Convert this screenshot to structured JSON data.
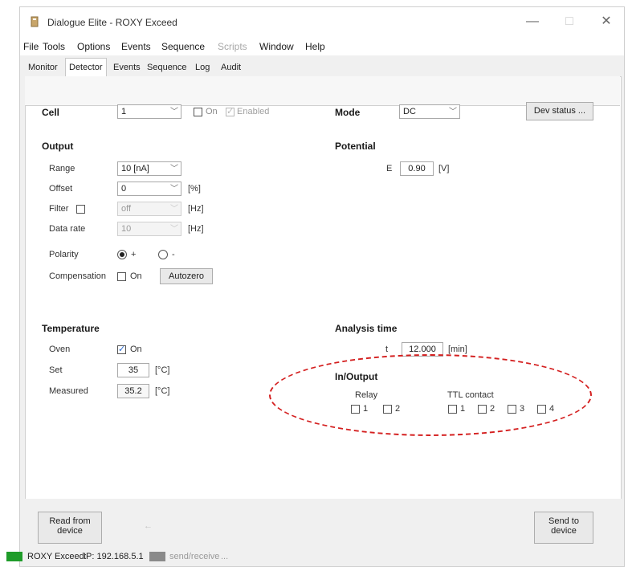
{
  "window": {
    "title": "Dialogue Elite - ROXY Exceed",
    "controls": {
      "minimize": "—",
      "maximize": "□",
      "close": "✕"
    }
  },
  "menu": [
    "File",
    "Tools",
    "Options",
    "Events",
    "Sequence",
    "Scripts",
    "Window",
    "Help"
  ],
  "tabs": [
    "Monitor",
    "Detector",
    "Events",
    "Sequence",
    "Log",
    "Audit"
  ],
  "header": {
    "cell_label": "Cell",
    "cell_value": "1",
    "on_label": "On",
    "enabled_label": "Enabled",
    "mode_label": "Mode",
    "mode_value": "DC",
    "dev_status_label": "Dev status ..."
  },
  "output": {
    "title": "Output",
    "range_label": "Range",
    "range_value": "10 [nA]",
    "offset_label": "Offset",
    "offset_value": "0",
    "offset_unit": "[%]",
    "filter_label": "Filter",
    "filter_value": "off",
    "filter_unit": "[Hz]",
    "datarate_label": "Data rate",
    "datarate_value": "10",
    "datarate_unit": "[Hz]",
    "polarity_label": "Polarity",
    "polarity_plus": "+",
    "polarity_minus": "-",
    "compensation_label": "Compensation",
    "comp_on_label": "On",
    "autozero_label": "Autozero"
  },
  "potential": {
    "title": "Potential",
    "e_label": "E",
    "e_value": "0.90",
    "e_unit": "[V]"
  },
  "temperature": {
    "title": "Temperature",
    "oven_label": "Oven",
    "oven_on_label": "On",
    "set_label": "Set",
    "set_value": "35",
    "set_unit": "[°C]",
    "measured_label": "Measured",
    "measured_value": "35.2",
    "measured_unit": "[°C]"
  },
  "analysis": {
    "title": "Analysis time",
    "t_label": "t",
    "t_value": "12.000",
    "t_unit": "[min]"
  },
  "inout": {
    "title": "In/Output",
    "relay_label": "Relay",
    "relay_items": [
      "1",
      "2"
    ],
    "ttl_label": "TTL contact",
    "ttl_items": [
      "1",
      "2",
      "3",
      "4"
    ]
  },
  "footer": {
    "read_line1": "Read from",
    "read_line2": "device",
    "arrow": "←",
    "send_line1": "Send to",
    "send_line2": "device"
  },
  "status": {
    "device": "ROXY Exceed:",
    "ip": "IP: 192.168.5.1",
    "send_receive": "send/receive",
    "ellipsis": "..."
  },
  "colors": {
    "annotation_ellipse": "#d42020",
    "status_ok": "#1f9c2a"
  }
}
